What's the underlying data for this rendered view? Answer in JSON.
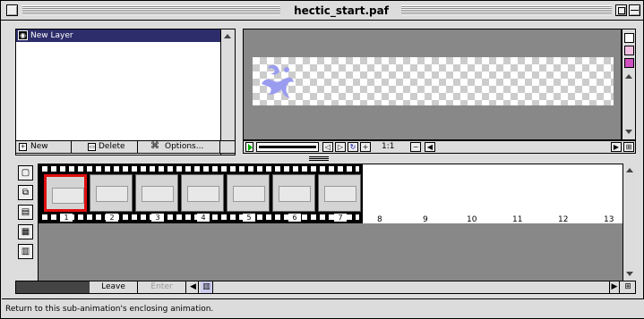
{
  "window": {
    "title": "hectic_start.paf"
  },
  "layers": {
    "items": [
      {
        "label": "New Layer"
      }
    ],
    "buttons": {
      "new": "New",
      "delete": "Delete",
      "options": "Options..."
    }
  },
  "preview": {
    "zoom": "1:1"
  },
  "timeline": {
    "frame_labels": [
      "1",
      "2",
      "3",
      "4",
      "5",
      "6",
      "7"
    ],
    "tick_labels": [
      "8",
      "9",
      "10",
      "11",
      "12",
      "13"
    ],
    "selected_frame": "1"
  },
  "bottom": {
    "leave": "Leave",
    "enter": "Enter"
  },
  "status": {
    "text": "Return to this sub-animation's enclosing animation."
  },
  "colors": {
    "layer_highlight": "#2d2d6b",
    "selected_frame": "#e01010",
    "sprite": "#9a9cf0"
  }
}
